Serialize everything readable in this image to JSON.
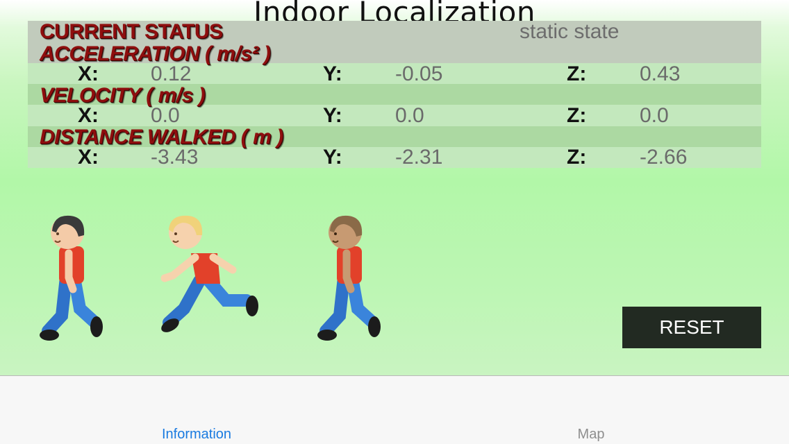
{
  "app": {
    "title": "Indoor Localization"
  },
  "status": {
    "heading": "CURRENT STATUS",
    "value": "static state"
  },
  "acceleration": {
    "heading": "ACCELERATION  ( m/s² )",
    "x_label": "X:",
    "y_label": "Y:",
    "z_label": "Z:",
    "x": "0.12",
    "y": "-0.05",
    "z": "0.43"
  },
  "velocity": {
    "heading": "VELOCITY  ( m/s )",
    "x_label": "X:",
    "y_label": "Y:",
    "z_label": "Z:",
    "x": "0.0",
    "y": "0.0",
    "z": "0.0"
  },
  "distance": {
    "heading": "DISTANCE WALKED  ( m )",
    "x_label": "X:",
    "y_label": "Y:",
    "z_label": "Z:",
    "x": "-3.43",
    "y": "-2.31",
    "z": "-2.66"
  },
  "figures": [
    {
      "icon": "walking-person-icon",
      "hair": "#3a3a3a",
      "skin": "#f4cba8"
    },
    {
      "icon": "running-person-icon",
      "hair": "#f0d27a",
      "skin": "#f6d2ad"
    },
    {
      "icon": "walking-person-icon",
      "hair": "#8a6a48",
      "skin": "#c79a72"
    }
  ],
  "reset_button": {
    "label": "RESET"
  },
  "tabs": [
    {
      "label": "Information",
      "selected": true
    },
    {
      "label": "Map",
      "selected": false
    }
  ],
  "colors": {
    "heading_red": "#8e0e0e",
    "tab_active": "#1a7be0",
    "tab_inactive": "#8e8e8e",
    "reset_bg": "#222a22"
  }
}
